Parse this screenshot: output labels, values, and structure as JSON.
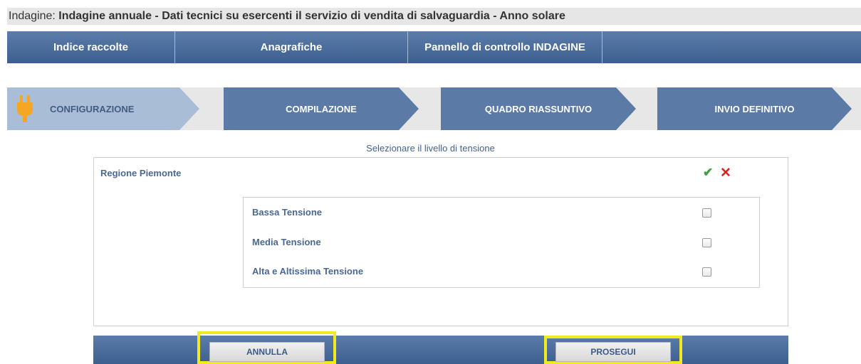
{
  "title": {
    "prefix": "Indagine: ",
    "text": "Indagine annuale - Dati tecnici su esercenti il servizio di vendita di salvaguardia - Anno solare"
  },
  "nav": [
    {
      "label": "Indice raccolte"
    },
    {
      "label": "Anagrafiche"
    },
    {
      "label": "Pannello di controllo INDAGINE"
    }
  ],
  "steps": [
    {
      "label": "CONFIGURAZIONE",
      "state": "active",
      "icon": "plug-icon"
    },
    {
      "label": "COMPILAZIONE",
      "state": "pending"
    },
    {
      "label": "QUADRO RIASSUNTIVO",
      "state": "pending"
    },
    {
      "label": "INVIO DEFINITIVO",
      "state": "pending"
    }
  ],
  "section_label": "Selezionare il livello di tensione",
  "region": {
    "name": "Regione Piemonte",
    "confirm_icon": "✔",
    "cancel_icon": "✕"
  },
  "options": [
    {
      "label": "Bassa Tensione",
      "checked": false
    },
    {
      "label": "Media Tensione",
      "checked": false
    },
    {
      "label": "Alta e Altissima Tensione",
      "checked": false
    }
  ],
  "buttons": {
    "cancel": "ANNULLA",
    "proceed": "PROSEGUI"
  },
  "colors": {
    "nav": "#4a6b9a",
    "step_active": "#a9bdd6",
    "step_pending": "#5b7aa6",
    "highlight": "#f2ea20",
    "accent_text": "#4a6794"
  }
}
